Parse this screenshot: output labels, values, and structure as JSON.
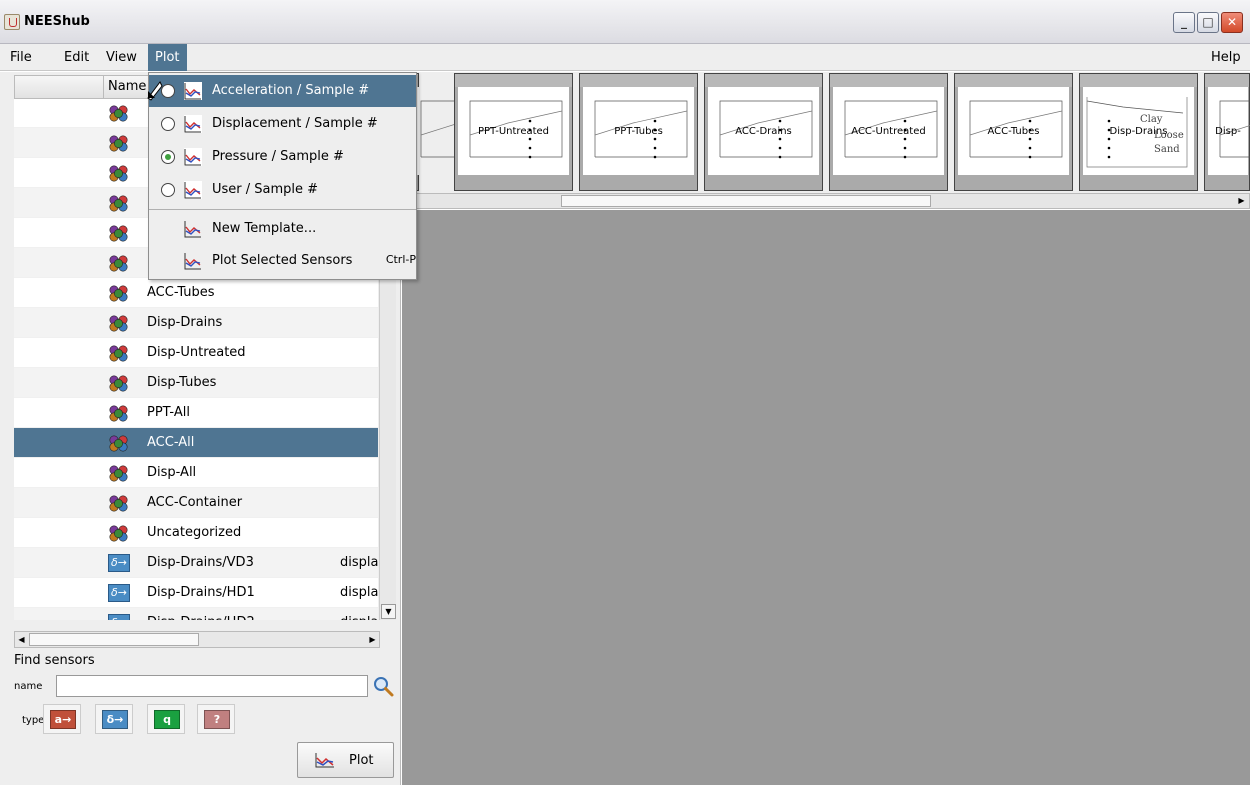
{
  "window": {
    "title": "NEEShub"
  },
  "menubar": {
    "items": [
      {
        "label": "File"
      },
      {
        "label": "Edit"
      },
      {
        "label": "View"
      },
      {
        "label": "Plot"
      }
    ],
    "help": "Help"
  },
  "plot_menu": {
    "items": [
      {
        "label": "Acceleration / Sample #",
        "selected": false,
        "highlighted": true
      },
      {
        "label": "Displacement / Sample #",
        "selected": false
      },
      {
        "label": "Pressure / Sample #",
        "selected": true
      },
      {
        "label": "User / Sample #",
        "selected": false
      }
    ],
    "new_template": "New Template...",
    "plot_selected": "Plot Selected Sensors",
    "plot_selected_shortcut": "Ctrl-P"
  },
  "sensor_table": {
    "column_name": "Name",
    "rows": [
      {
        "name": "",
        "kind": "group"
      },
      {
        "name": "",
        "kind": "group"
      },
      {
        "name": "",
        "kind": "group"
      },
      {
        "name": "",
        "kind": "group"
      },
      {
        "name": "",
        "kind": "group"
      },
      {
        "name": "",
        "kind": "group"
      },
      {
        "name": "ACC-Tubes",
        "kind": "group"
      },
      {
        "name": "Disp-Drains",
        "kind": "group"
      },
      {
        "name": "Disp-Untreated",
        "kind": "group"
      },
      {
        "name": "Disp-Tubes",
        "kind": "group"
      },
      {
        "name": "PPT-All",
        "kind": "group"
      },
      {
        "name": "ACC-All",
        "kind": "group",
        "selected": true
      },
      {
        "name": "Disp-All",
        "kind": "group"
      },
      {
        "name": "ACC-Container",
        "kind": "group"
      },
      {
        "name": "Uncategorized",
        "kind": "group"
      },
      {
        "name": "Disp-Drains/VD3",
        "kind": "displacement",
        "extra": "displa"
      },
      {
        "name": "Disp-Drains/HD1",
        "kind": "displacement",
        "extra": "displa"
      },
      {
        "name": "Disp-Drains/HD2",
        "kind": "displacement",
        "extra": "displa"
      }
    ]
  },
  "find_sensors": {
    "heading": "Find sensors",
    "name_label": "name",
    "name_value": "",
    "type_label": "type",
    "types": [
      {
        "glyph": "a→",
        "color": "#c0503a"
      },
      {
        "glyph": "δ→",
        "color": "#4a8cc4"
      },
      {
        "glyph": "q",
        "color": "#1aa040"
      },
      {
        "glyph": "?",
        "color": "#c08080"
      }
    ],
    "plot_button": "Plot"
  },
  "thumbnails": [
    {
      "title": ""
    },
    {
      "title": "PPT-Untreated"
    },
    {
      "title": "PPT-Tubes"
    },
    {
      "title": "ACC-Drains"
    },
    {
      "title": "ACC-Untreated"
    },
    {
      "title": "ACC-Tubes"
    },
    {
      "title": "Disp-Drains",
      "notes": [
        "Clay",
        "Loose",
        "Sand"
      ]
    },
    {
      "title": "Disp-"
    }
  ],
  "colors": {
    "accent": "#4f7592",
    "workspace": "#999999"
  }
}
